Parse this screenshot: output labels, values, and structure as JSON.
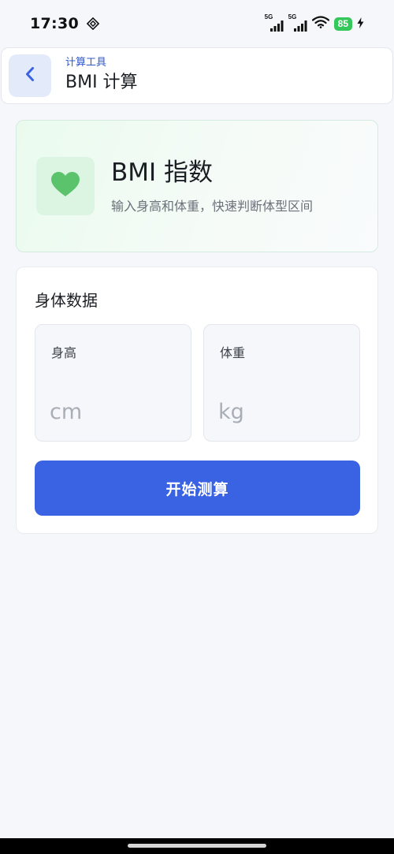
{
  "status_bar": {
    "time": "17:30",
    "network_1": "5G",
    "network_2": "5G",
    "battery": "85"
  },
  "header": {
    "subtitle": "计算工具",
    "title": "BMI 计算",
    "back_icon": "chevron-left-icon"
  },
  "intro": {
    "icon": "heart-icon",
    "title": "BMI 指数",
    "description": "输入身高和体重，快速判断体型区间"
  },
  "form": {
    "title": "身体数据",
    "height": {
      "label": "身高",
      "value": "",
      "placeholder": "cm"
    },
    "weight": {
      "label": "体重",
      "value": "",
      "placeholder": "kg"
    },
    "submit_label": "开始测算"
  },
  "colors": {
    "accent": "#3a63e3",
    "header_subtitle": "#2f57c9",
    "heart": "#5cc36d",
    "battery": "#34c759"
  }
}
